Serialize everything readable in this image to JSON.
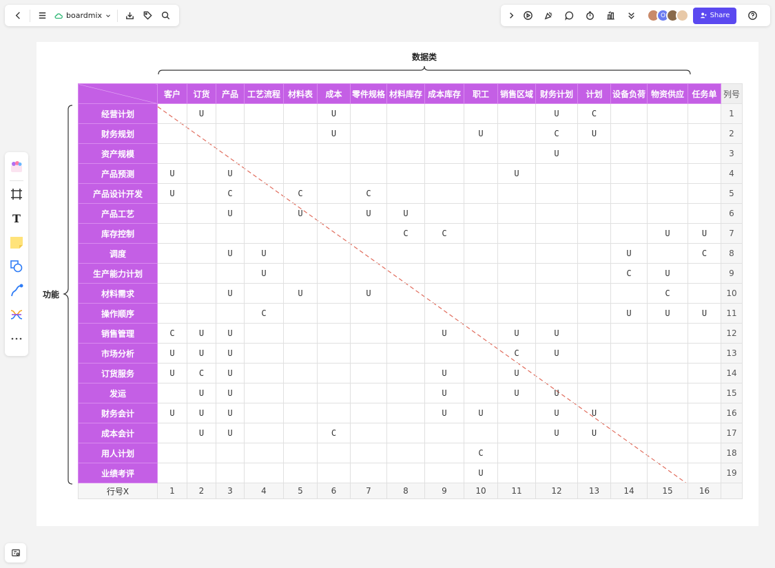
{
  "app": {
    "brand_name": "boardmix",
    "share_label": "Share",
    "colors": {
      "accent": "#5b49f0",
      "header_purple": "#c45fe5",
      "diagonal": "#e06b5b"
    }
  },
  "topbar_left": {
    "icons": [
      "back-arrow-icon",
      "menu-icon",
      "cloud-icon",
      "chevron-down-icon",
      "download-icon",
      "tag-icon",
      "search-icon"
    ]
  },
  "topbar_right": {
    "icons": [
      "expand-chevron-icon",
      "play-icon",
      "celebrate-icon",
      "comment-icon",
      "timer-icon",
      "vote-icon",
      "more-chevron-icon",
      "help-icon"
    ],
    "avatars": [
      {
        "name": "user-avatar-1",
        "color": "#c98a6a",
        "text": ""
      },
      {
        "name": "user-avatar-2",
        "color": "#6b7cf0",
        "text": "O"
      },
      {
        "name": "user-avatar-3",
        "color": "#8a6a4a",
        "text": ""
      },
      {
        "name": "user-avatar-4",
        "color": "#e8c9a8",
        "text": ""
      }
    ]
  },
  "left_toolbar": {
    "icons": [
      "template-icon",
      "frame-icon",
      "text-icon",
      "sticky-note-icon",
      "shape-icon",
      "pen-icon",
      "mindmap-icon",
      "more-tools-icon"
    ]
  },
  "matrix": {
    "top_brace_label": "数据类",
    "left_brace_label": "功能",
    "row_number_header": "列号",
    "column_number_label": "行号X",
    "columns": [
      "客户",
      "订货",
      "产品",
      "工艺流程",
      "材料表",
      "成本",
      "零件规格",
      "材料库存",
      "成本库存",
      "职工",
      "销售区域",
      "财务计划",
      "计划",
      "设备负荷",
      "物资供应",
      "任务单"
    ],
    "column_numbers": [
      "1",
      "2",
      "3",
      "4",
      "5",
      "6",
      "7",
      "8",
      "9",
      "10",
      "11",
      "12",
      "13",
      "14",
      "15",
      "16"
    ],
    "rows": [
      {
        "label": "经营计划",
        "no": "1",
        "cells": [
          "",
          "U",
          "",
          "",
          "",
          "U",
          "",
          "",
          "",
          "",
          "",
          "U",
          "C",
          "",
          "",
          ""
        ]
      },
      {
        "label": "财务规划",
        "no": "2",
        "cells": [
          "",
          "",
          "",
          "",
          "",
          "U",
          "",
          "",
          "",
          "U",
          "",
          "C",
          "U",
          "",
          "",
          ""
        ]
      },
      {
        "label": "资产规模",
        "no": "3",
        "cells": [
          "",
          "",
          "",
          "",
          "",
          "",
          "",
          "",
          "",
          "",
          "",
          "U",
          "",
          "",
          "",
          ""
        ]
      },
      {
        "label": "产品预测",
        "no": "4",
        "cells": [
          "U",
          "",
          "U",
          "",
          "",
          "",
          "",
          "",
          "",
          "",
          "U",
          "",
          "",
          "",
          "",
          ""
        ]
      },
      {
        "label": "产品设计开发",
        "no": "5",
        "cells": [
          "U",
          "",
          "C",
          "",
          "C",
          "",
          "C",
          "",
          "",
          "",
          "",
          "",
          "",
          "",
          "",
          ""
        ]
      },
      {
        "label": "产品工艺",
        "no": "6",
        "cells": [
          "",
          "",
          "U",
          "",
          "U",
          "",
          "U",
          "U",
          "",
          "",
          "",
          "",
          "",
          "",
          "",
          ""
        ]
      },
      {
        "label": "库存控制",
        "no": "7",
        "cells": [
          "",
          "",
          "",
          "",
          "",
          "",
          "",
          "C",
          "C",
          "",
          "",
          "",
          "",
          "",
          "U",
          "U"
        ]
      },
      {
        "label": "调度",
        "no": "8",
        "cells": [
          "",
          "",
          "U",
          "U",
          "",
          "",
          "",
          "",
          "",
          "",
          "",
          "",
          "",
          "U",
          "",
          "C"
        ]
      },
      {
        "label": "生产能力计划",
        "no": "9",
        "cells": [
          "",
          "",
          "",
          "U",
          "",
          "",
          "",
          "",
          "",
          "",
          "",
          "",
          "",
          "C",
          "U",
          ""
        ]
      },
      {
        "label": "材料需求",
        "no": "10",
        "cells": [
          "",
          "",
          "U",
          "",
          "U",
          "",
          "U",
          "",
          "",
          "",
          "",
          "",
          "",
          "",
          "C",
          ""
        ]
      },
      {
        "label": "操作顺序",
        "no": "11",
        "cells": [
          "",
          "",
          "",
          "C",
          "",
          "",
          "",
          "",
          "",
          "",
          "",
          "",
          "",
          "U",
          "U",
          "U"
        ]
      },
      {
        "label": "销售管理",
        "no": "12",
        "cells": [
          "C",
          "U",
          "U",
          "",
          "",
          "",
          "",
          "",
          "U",
          "",
          "U",
          "U",
          "",
          "",
          "",
          ""
        ]
      },
      {
        "label": "市场分析",
        "no": "13",
        "cells": [
          "U",
          "U",
          "U",
          "",
          "",
          "",
          "",
          "",
          "",
          "",
          "C",
          "U",
          "",
          "",
          "",
          ""
        ]
      },
      {
        "label": "订货服务",
        "no": "14",
        "cells": [
          "U",
          "C",
          "U",
          "",
          "",
          "",
          "",
          "",
          "U",
          "",
          "U",
          "",
          "",
          "",
          "",
          ""
        ]
      },
      {
        "label": "发运",
        "no": "15",
        "cells": [
          "",
          "U",
          "U",
          "",
          "",
          "",
          "",
          "",
          "U",
          "",
          "U",
          "U",
          "",
          "",
          "",
          ""
        ]
      },
      {
        "label": "财务会计",
        "no": "16",
        "cells": [
          "U",
          "U",
          "U",
          "",
          "",
          "",
          "",
          "",
          "U",
          "U",
          "",
          "U",
          "U",
          "",
          "",
          ""
        ]
      },
      {
        "label": "成本会计",
        "no": "17",
        "cells": [
          "",
          "U",
          "U",
          "",
          "",
          "C",
          "",
          "",
          "",
          "",
          "",
          "U",
          "U",
          "",
          "",
          ""
        ]
      },
      {
        "label": "用人计划",
        "no": "18",
        "cells": [
          "",
          "",
          "",
          "",
          "",
          "",
          "",
          "",
          "",
          "C",
          "",
          "",
          "",
          "",
          "",
          ""
        ]
      },
      {
        "label": "业绩考评",
        "no": "19",
        "cells": [
          "",
          "",
          "",
          "",
          "",
          "",
          "",
          "",
          "",
          "U",
          "",
          "",
          "",
          "",
          "",
          ""
        ]
      }
    ]
  }
}
